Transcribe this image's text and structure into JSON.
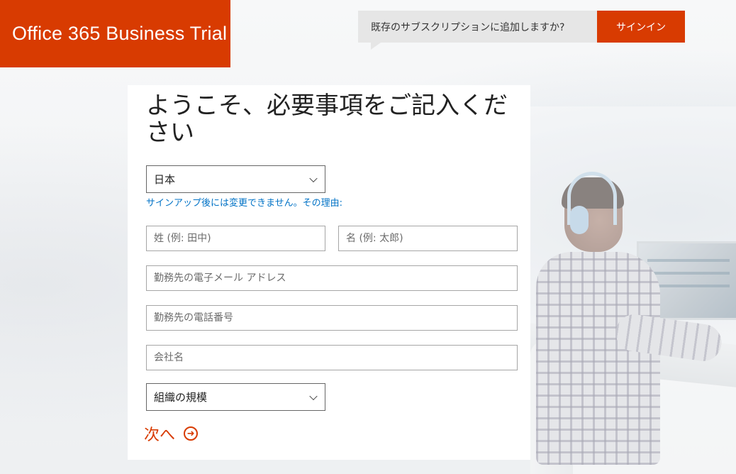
{
  "brand": {
    "title": "Office 365 Business Trial",
    "color": "#d83b01"
  },
  "header": {
    "existing_subscription_prompt": "既存のサブスクリプションに追加しますか?",
    "signin_label": "サインイン"
  },
  "form": {
    "heading": "ようこそ、必要事項をご記入ください",
    "country": {
      "selected": "日本"
    },
    "country_note_link": "サインアップ後には変更できません。その理由:",
    "last_name": {
      "placeholder": "姓 (例: 田中)",
      "value": ""
    },
    "first_name": {
      "placeholder": "名 (例: 太郎)",
      "value": ""
    },
    "work_email": {
      "placeholder": "勤務先の電子メール アドレス",
      "value": ""
    },
    "work_phone": {
      "placeholder": "勤務先の電話番号",
      "value": ""
    },
    "company": {
      "placeholder": "会社名",
      "value": ""
    },
    "org_size": {
      "selected": "組織の規模"
    },
    "next_label": "次へ",
    "next_icon": "arrow-circle-right-icon"
  },
  "colors": {
    "accent": "#d83b01",
    "link": "#0072c6",
    "callout_bg": "#e6e6e6"
  }
}
